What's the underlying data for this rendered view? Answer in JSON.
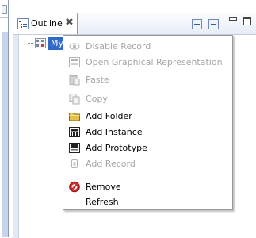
{
  "outline_view": {
    "tab_title": "Outline",
    "tree": {
      "selected_item_label": "MyD"
    }
  },
  "context_menu": {
    "items": [
      {
        "label": "Disable Record",
        "enabled": false,
        "icon": "eye-icon"
      },
      {
        "label": "Open Graphical Representation",
        "enabled": false,
        "icon": "pro-badge-icon"
      },
      {
        "label": "Paste",
        "enabled": false,
        "icon": "clipboard-icon"
      },
      {
        "label": "Copy",
        "enabled": false,
        "icon": "copy-icon"
      },
      {
        "label": "Add Folder",
        "enabled": true,
        "icon": "folder-icon"
      },
      {
        "label": "Add Instance",
        "enabled": true,
        "icon": "ins-badge-icon"
      },
      {
        "label": "Add Prototype",
        "enabled": true,
        "icon": "pro-badge-icon"
      },
      {
        "label": "Add Record",
        "enabled": false,
        "icon": "record-icon"
      },
      {
        "label": "Remove",
        "enabled": true,
        "icon": "remove-icon"
      },
      {
        "label": "Refresh",
        "enabled": true,
        "icon": ""
      }
    ]
  },
  "colors": {
    "selection": "#316ac5",
    "disabled_text": "#a6a6a6",
    "remove_icon": "#d32b2b",
    "folder_icon": "#e7c24a"
  }
}
